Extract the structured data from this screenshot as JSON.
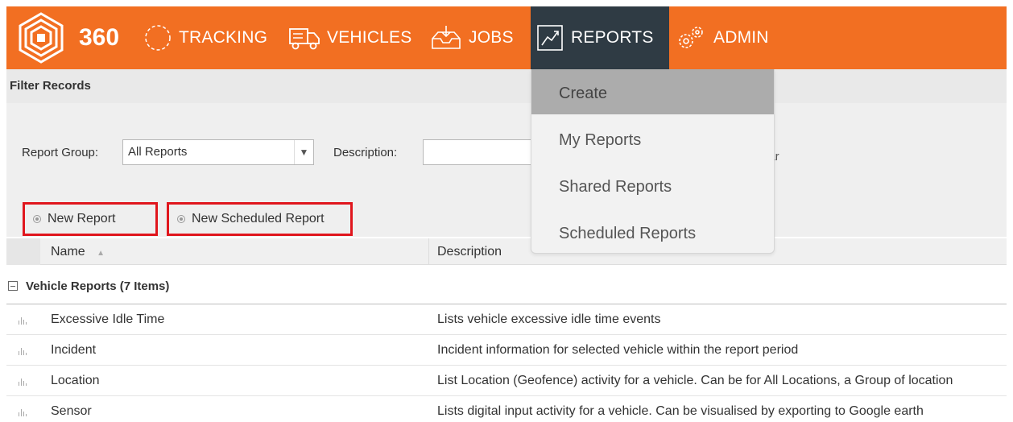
{
  "brand": {
    "text": "360",
    "logo_icon": "hexagon-logo-icon"
  },
  "nav": [
    {
      "label": "TRACKING",
      "icon": "circle-dashed-icon"
    },
    {
      "label": "VEHICLES",
      "icon": "truck-icon"
    },
    {
      "label": "JOBS",
      "icon": "inbox-icon"
    },
    {
      "label": "REPORTS",
      "icon": "chart-line-icon",
      "active": true
    },
    {
      "label": "ADMIN",
      "icon": "gears-icon"
    }
  ],
  "filter": {
    "title": "Filter Records",
    "group_label": "Report Group:",
    "group_value": "All Reports",
    "description_label": "Description:",
    "description_value": "",
    "clear_fragment": "ear"
  },
  "actions": {
    "new_report": "New Report",
    "new_scheduled_report": "New Scheduled Report"
  },
  "table": {
    "col_name": "Name",
    "col_description": "Description",
    "group_label": "Vehicle Reports (7 Items)",
    "rows": [
      {
        "name": "Excessive Idle Time",
        "description": "Lists vehicle excessive idle time events"
      },
      {
        "name": "Incident",
        "description": "Incident information for selected vehicle within the report period"
      },
      {
        "name": "Location",
        "description": "List Location (Geofence) activity for a vehicle. Can be for All Locations, a Group of location"
      },
      {
        "name": "Sensor",
        "description": "Lists digital input activity for a vehicle. Can be visualised by exporting to Google earth"
      }
    ]
  },
  "reports_menu": [
    {
      "label": "Create",
      "highlighted": true
    },
    {
      "label": "My Reports"
    },
    {
      "label": "Shared Reports"
    },
    {
      "label": "Scheduled Reports"
    }
  ],
  "colors": {
    "accent": "#f26f22",
    "active_nav": "#2f3b44",
    "highlight_border": "#e0161d"
  }
}
